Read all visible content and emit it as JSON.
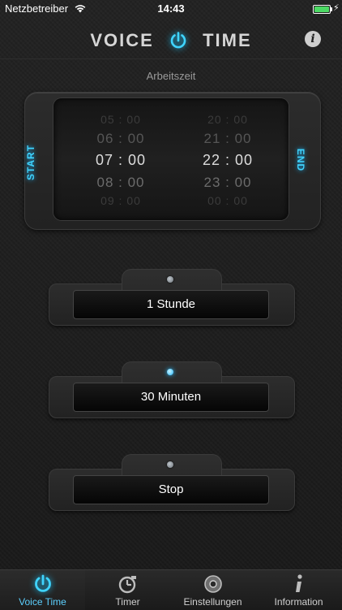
{
  "status_bar": {
    "carrier": "Netzbetreiber",
    "time": "14:43"
  },
  "header": {
    "logo_left": "VOICE",
    "logo_right": "TIME",
    "info_glyph": "i"
  },
  "section": {
    "label": "Arbeitszeit"
  },
  "picker": {
    "start_label": "START",
    "end_label": "END",
    "start_times": [
      "05 : 00",
      "06 : 00",
      "07 : 00",
      "08 : 00",
      "09 : 00"
    ],
    "end_times": [
      "20 : 00",
      "21 : 00",
      "22 : 00",
      "23 : 00",
      "00 : 00"
    ]
  },
  "buttons": [
    {
      "label": "1 Stunde",
      "led": "off"
    },
    {
      "label": "30 Minuten",
      "led": "on"
    },
    {
      "label": "Stop",
      "led": "off"
    }
  ],
  "tabbar": {
    "items": [
      {
        "label": "Voice Time",
        "icon": "power-icon",
        "active": true
      },
      {
        "label": "Timer",
        "icon": "clock-icon",
        "active": false
      },
      {
        "label": "Einstellungen",
        "icon": "settings-disc-icon",
        "active": false
      },
      {
        "label": "Information",
        "icon": "info-icon",
        "active": false
      }
    ]
  },
  "colors": {
    "accent": "#3fd4ff",
    "background": "#1c1c1c",
    "button_text": "#ffffff"
  }
}
